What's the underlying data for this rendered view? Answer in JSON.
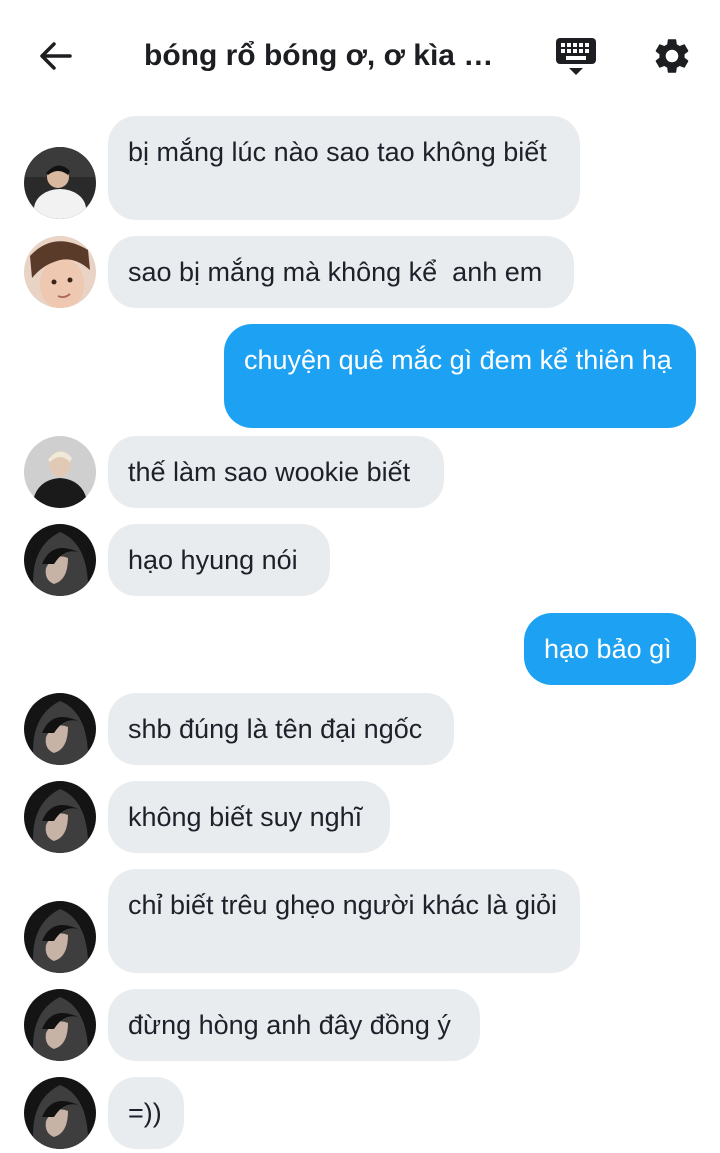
{
  "header": {
    "title": "bóng rổ bóng ơ, ơ kìa b..."
  },
  "colors": {
    "incoming_bubble": "#e9ecef",
    "outgoing_bubble": "#1da1f2",
    "text_dark": "#1d2129"
  },
  "messages": [
    {
      "direction": "in",
      "avatar": "avatar-white-shirt",
      "text": "bị mắng lúc nào sao tao không biết"
    },
    {
      "direction": "in",
      "avatar": "avatar-brown-hair",
      "text": "sao bị mắng mà không kể  anh em"
    },
    {
      "direction": "out",
      "text": "chuyện quê mắc gì đem kể thiên hạ"
    },
    {
      "direction": "in",
      "avatar": "avatar-blond-black-jacket",
      "text": "thế làm sao wookie biết"
    },
    {
      "direction": "in",
      "avatar": "avatar-dark-hood",
      "text": "hạo hyung nói"
    },
    {
      "direction": "out",
      "text": "hạo bảo gì"
    },
    {
      "direction": "in",
      "avatar": "avatar-dark-hood",
      "text": "shb đúng là tên đại ngốc"
    },
    {
      "direction": "in",
      "avatar": "avatar-dark-hood",
      "text": "không biết suy nghĩ"
    },
    {
      "direction": "in",
      "avatar": "avatar-dark-hood",
      "text": "chỉ biết trêu ghẹo người khác là giỏi"
    },
    {
      "direction": "in",
      "avatar": "avatar-dark-hood",
      "text": "đừng hòng anh đây đồng ý"
    },
    {
      "direction": "in",
      "avatar": "avatar-dark-hood",
      "text": "=))"
    }
  ]
}
